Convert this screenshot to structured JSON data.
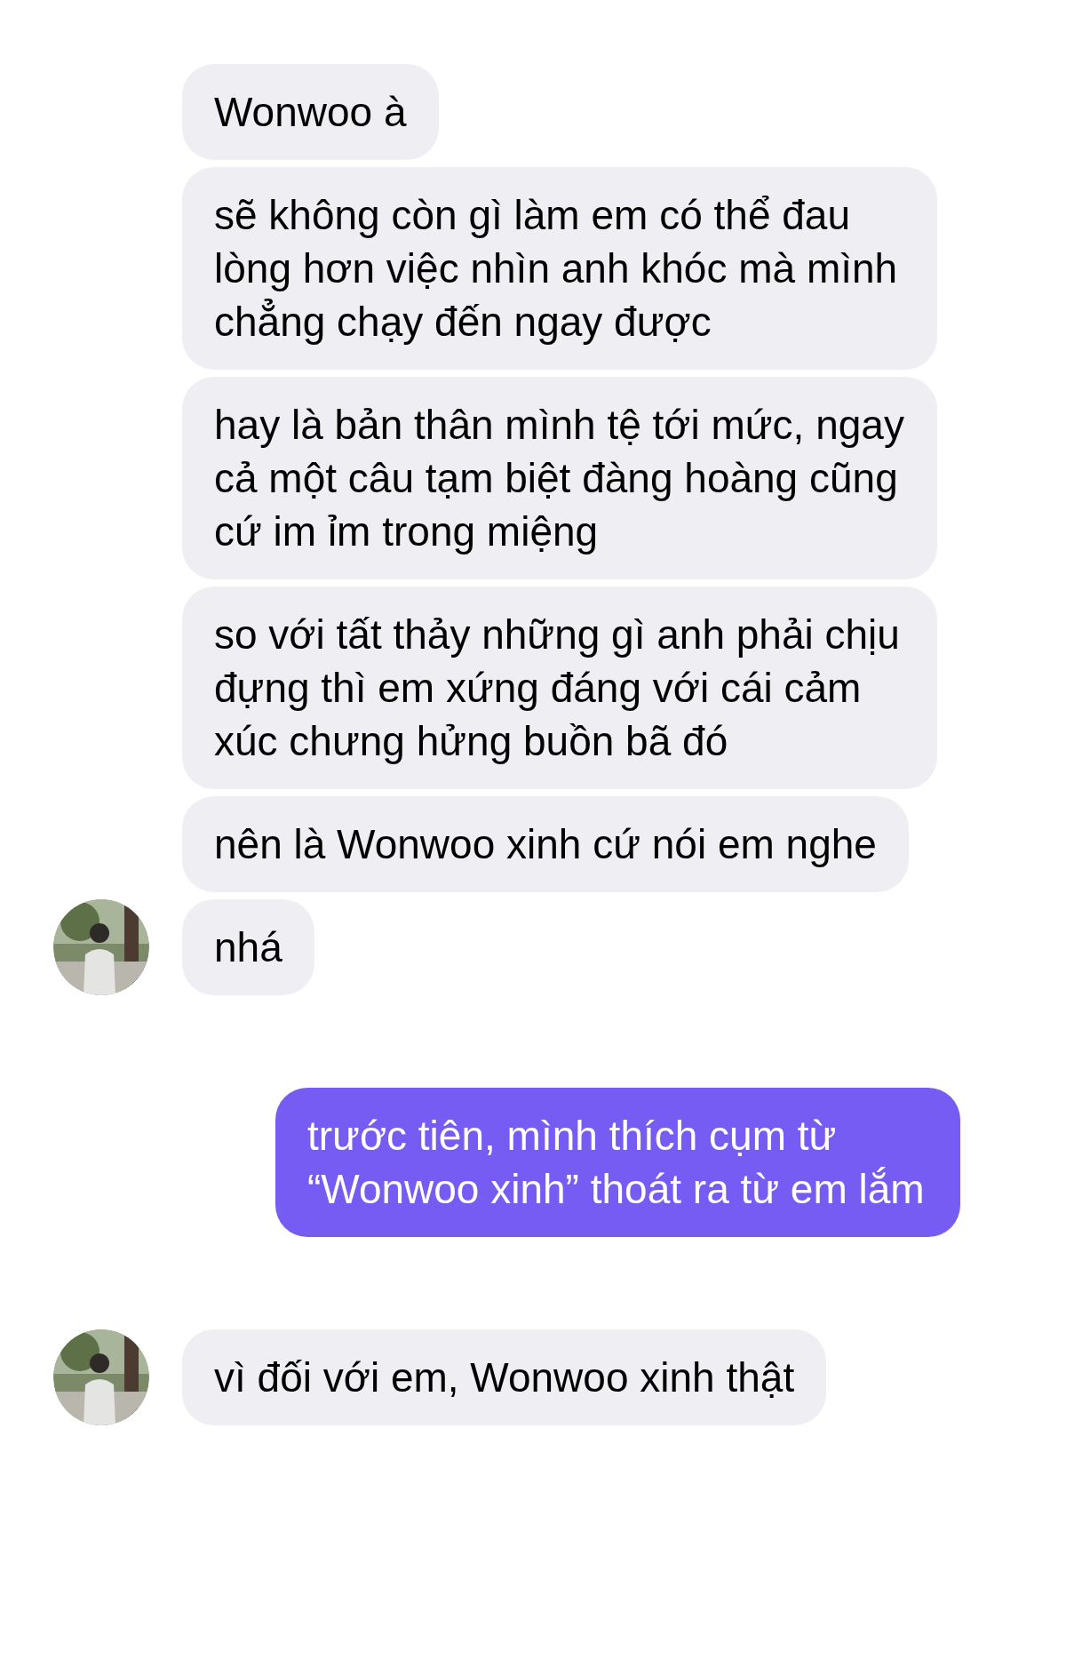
{
  "groups": [
    {
      "kind": "received",
      "messages": [
        "Wonwoo à",
        "sẽ không còn gì làm em có thể đau lòng hơn việc nhìn anh khóc mà mình chẳng chạy đến ngay được",
        "hay là bản thân mình tệ tới mức, ngay cả một câu tạm biệt đàng hoàng cũng cứ im ỉm trong miệng",
        "so với tất thảy những gì anh phải chịu đựng thì em xứng đáng với cái cảm xúc chưng hửng buồn bã đó",
        "nên là Wonwoo xinh cứ nói em nghe",
        "nhá"
      ]
    },
    {
      "kind": "sent",
      "messages": [
        "trước tiên, mình thích cụm từ “Wonwoo xinh” thoát ra từ em lắm"
      ]
    },
    {
      "kind": "received",
      "messages": [
        "vì đối với em, Wonwoo xinh thật"
      ]
    }
  ]
}
